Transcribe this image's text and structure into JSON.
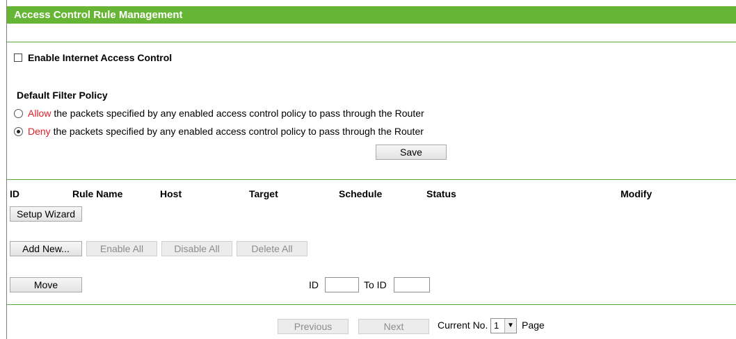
{
  "title": "Access Control Rule Management",
  "enable_control": {
    "label": "Enable Internet Access Control",
    "checked": false
  },
  "policy": {
    "heading": "Default Filter Policy",
    "allow": {
      "keyword": "Allow",
      "text": "the packets specified by any enabled access control policy to pass through the Router",
      "selected": false
    },
    "deny": {
      "keyword": "Deny",
      "text": "the packets specified by any enabled access control policy to pass through the Router",
      "selected": true
    },
    "save_label": "Save"
  },
  "table": {
    "columns": [
      "ID",
      "Rule Name",
      "Host",
      "Target",
      "Schedule",
      "Status",
      "Modify"
    ]
  },
  "buttons": {
    "setup_wizard": "Setup Wizard",
    "add_new": "Add New...",
    "enable_all": "Enable All",
    "disable_all": "Disable All",
    "delete_all": "Delete All",
    "move": "Move"
  },
  "move": {
    "id_label": "ID",
    "to_id_label": "To ID",
    "id_value": "",
    "to_id_value": ""
  },
  "pager": {
    "previous": "Previous",
    "next": "Next",
    "current_label": "Current No.",
    "current_value": "1",
    "page_label": "Page"
  },
  "colors": {
    "title_bar": "#66b535",
    "divider": "#5aa63a",
    "keyword": "#e0202a"
  }
}
